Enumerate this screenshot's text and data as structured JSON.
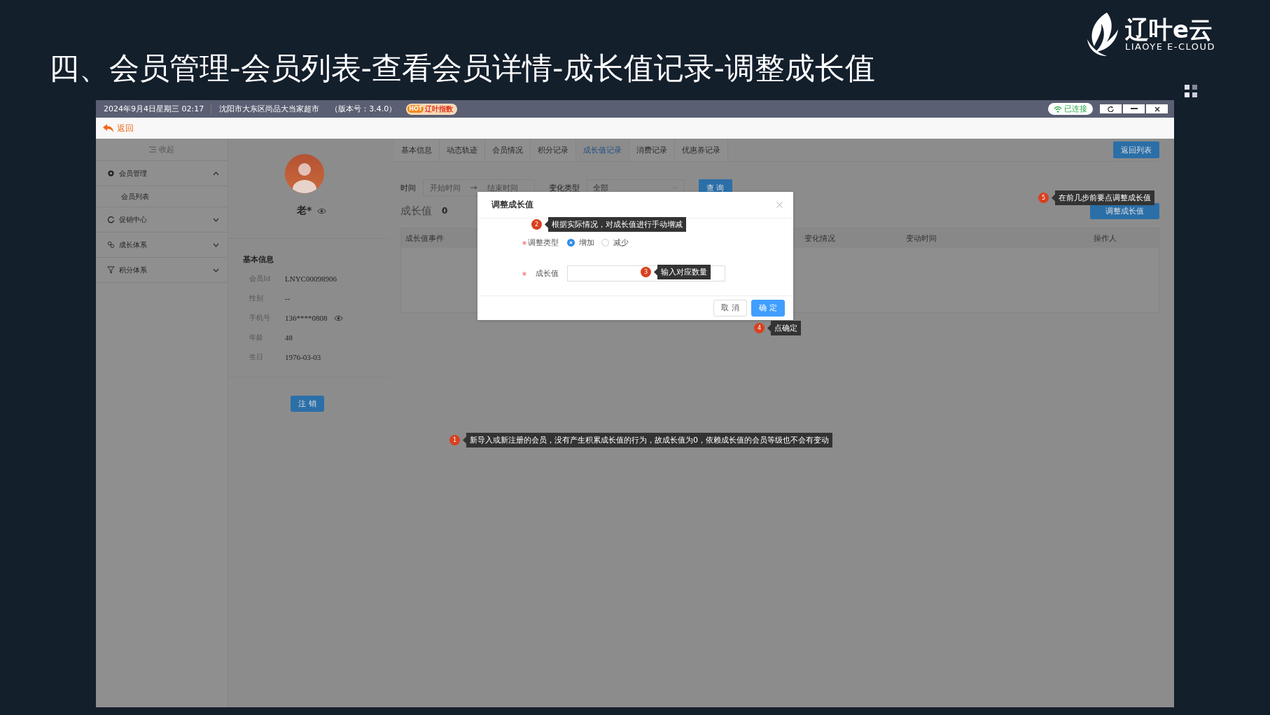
{
  "slide_title": "四、会员管理-会员列表-查看会员详情-成长值记录-调整成长值",
  "logo": {
    "name": "辽叶e云",
    "tagline": "LIAOYE E-CLOUD"
  },
  "titlebar": {
    "datetime": "2024年9月4日星期三 02:17",
    "store": "沈阳市大东区尚品大当家超市",
    "version": "（版本号：3.4.0）",
    "badge_hot": "HOT",
    "badge": "辽叶指数",
    "connection": "已连接"
  },
  "back": "返回",
  "sidebar": {
    "collapse": "收起",
    "items": [
      {
        "label": "会员管理",
        "expanded": true,
        "children": [
          {
            "label": "会员列表"
          }
        ]
      },
      {
        "label": "促销中心",
        "expanded": false
      },
      {
        "label": "成长体系",
        "expanded": false
      },
      {
        "label": "积分体系",
        "expanded": false
      }
    ]
  },
  "profile": {
    "name": "老*",
    "section": "基本信息",
    "fields": [
      {
        "label": "会员Id",
        "value": "LNYC00098906",
        "reveal": false
      },
      {
        "label": "性别",
        "value": "--",
        "reveal": false
      },
      {
        "label": "手机号",
        "value": "136****0808",
        "reveal": true
      },
      {
        "label": "年龄",
        "value": "48",
        "reveal": false
      },
      {
        "label": "生日",
        "value": "1976-03-03",
        "reveal": false
      }
    ],
    "cancel_button": "注 销"
  },
  "tabs": [
    {
      "label": "基本信息",
      "selected": false
    },
    {
      "label": "动态轨迹",
      "selected": false
    },
    {
      "label": "会员情况",
      "selected": false
    },
    {
      "label": "积分记录",
      "selected": false
    },
    {
      "label": "成长值记录",
      "selected": true
    },
    {
      "label": "消费记录",
      "selected": false
    },
    {
      "label": "优惠券记录",
      "selected": false
    }
  ],
  "return_button": "返回列表",
  "filters": {
    "time_label": "时间",
    "start_placeholder": "开始时间",
    "end_placeholder": "结束时间",
    "type_label": "变化类型",
    "type_value": "全部",
    "query_button": "查 询"
  },
  "growth": {
    "label": "成长值",
    "value": "0"
  },
  "adjust_button": "调整成长值",
  "table": {
    "columns": [
      "成长值事件",
      "变化情况",
      "变动时间",
      "操作人"
    ]
  },
  "dialog": {
    "title": "调整成长值",
    "fields": [
      {
        "kind": "radio",
        "label": "调整类型",
        "required": true,
        "options": [
          {
            "label": "增加",
            "selected": true
          },
          {
            "label": "减少",
            "selected": false
          }
        ]
      },
      {
        "kind": "input",
        "label": "成长值",
        "required": true
      }
    ],
    "cancel": "取 消",
    "ok": "确 定"
  },
  "annotations": [
    {
      "number": "1",
      "text": "新导入或新注册的会员，没有产生积累成长值的行为，故成长值为0，依赖成长值的会员等级也不会有变动"
    },
    {
      "number": "2",
      "text": "根据实际情况，对成长值进行手动增减"
    },
    {
      "number": "3",
      "text": "输入对应数量"
    },
    {
      "number": "4",
      "text": "点确定"
    },
    {
      "number": "5",
      "text": "在前几步前要点调整成长值"
    }
  ]
}
